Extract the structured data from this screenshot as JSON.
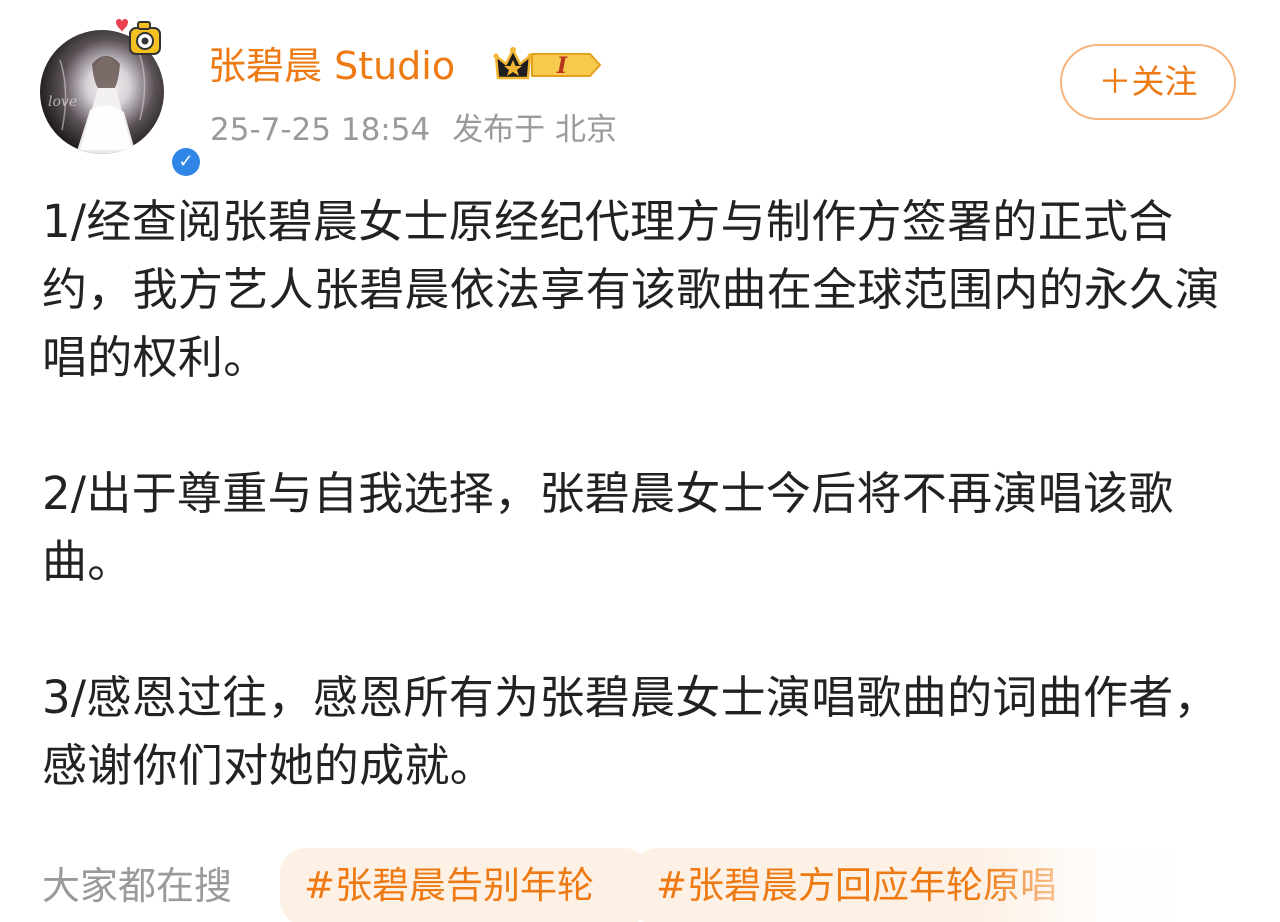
{
  "author": {
    "name": "张碧晨 Studio",
    "level_badge": "I",
    "verified": true
  },
  "post_meta": {
    "time": "25-7-25 18:54",
    "location": "发布于 北京"
  },
  "follow_button": {
    "label": "＋关注"
  },
  "post_body": {
    "paragraph_1": "1/经查阅张碧晨女士原经纪代理方与制作方签署的正式合约，我方艺人张碧晨依法享有该歌曲在全球范围内的永久演唱的权利。",
    "paragraph_2": "2/出于尊重与自我选择，张碧晨女士今后将不再演唱该歌曲。",
    "paragraph_3": "3/感恩过往，感恩所有为张碧晨女士演唱歌曲的词曲作者，感谢你们对她的成就。"
  },
  "trending": {
    "label": "大家都在搜",
    "topics": [
      "#张碧晨告别年轮",
      "#张碧晨方回应年轮原唱"
    ]
  },
  "colors": {
    "accent": "#ee7a14",
    "accent_light_bg": "#fdf1e6",
    "secondary_text": "#9a9a9a",
    "body_text": "#222222",
    "verified_blue": "#2f86e6"
  }
}
